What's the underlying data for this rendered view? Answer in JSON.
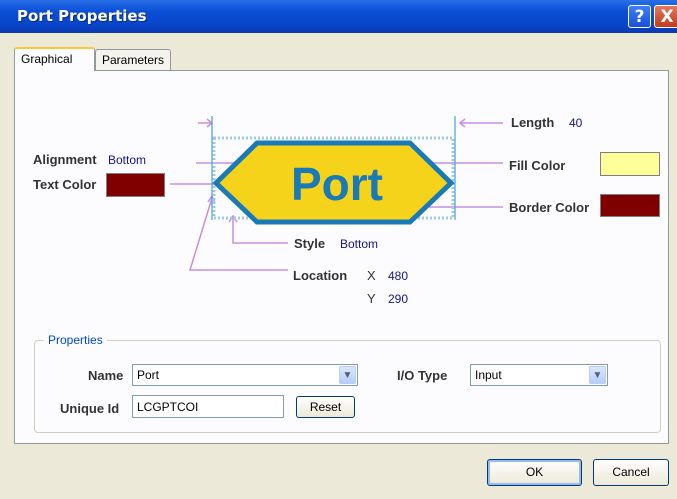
{
  "window": {
    "title": "Port Properties",
    "help_label": "?",
    "close_label": "X"
  },
  "tabs": [
    {
      "label": "Graphical"
    },
    {
      "label": "Parameters"
    }
  ],
  "graphic": {
    "port_text": "Port",
    "port_fill_color": "#f5d31a",
    "port_border_color": "#1a7ab8",
    "port_text_color": "#1a7ab8",
    "leader_color": "#c78ee0"
  },
  "properties_graphic": {
    "length_label": "Length",
    "length_value": "40",
    "alignment_label": "Alignment",
    "alignment_value": "Bottom",
    "text_color_label": "Text Color",
    "text_color": "#800000",
    "fill_color_label": "Fill Color",
    "fill_color": "#ffff99",
    "border_color_label": "Border Color",
    "border_color": "#800000",
    "style_label": "Style",
    "style_value": "Bottom",
    "location_label": "Location",
    "x_label": "X",
    "x_value": "480",
    "y_label": "Y",
    "y_value": "290"
  },
  "properties_group": {
    "title": "Properties",
    "name_label": "Name",
    "name_value": "Port",
    "io_type_label": "I/O Type",
    "io_type_value": "Input",
    "unique_id_label": "Unique Id",
    "unique_id_value": "LCGPTCOI",
    "reset_label": "Reset"
  },
  "footer": {
    "ok_label": "OK",
    "cancel_label": "Cancel"
  }
}
